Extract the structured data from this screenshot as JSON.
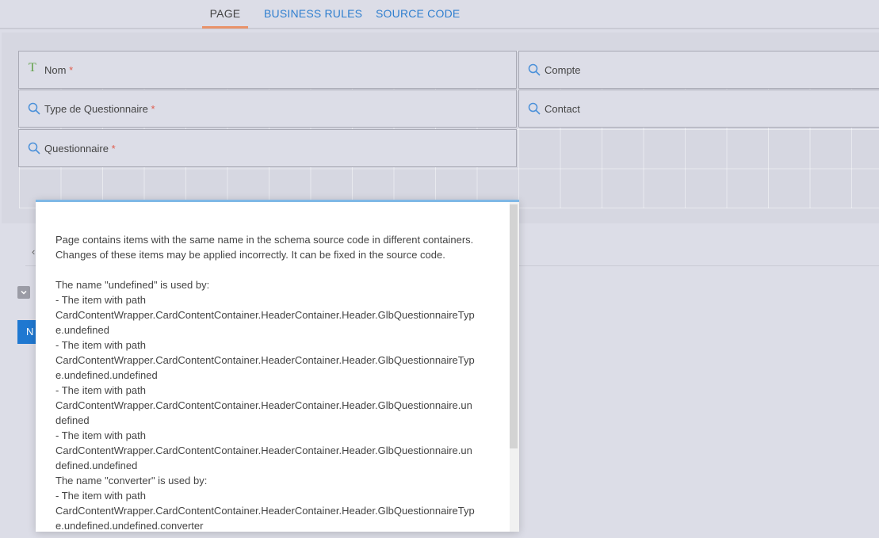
{
  "tabs": [
    {
      "label": "PAGE",
      "active": true
    },
    {
      "label": "BUSINESS RULES",
      "active": false
    },
    {
      "label": "SOURCE CODE",
      "active": false
    }
  ],
  "fields": {
    "nom": {
      "label": "Nom",
      "required": "*",
      "icon": "text-type-icon"
    },
    "compte": {
      "label": "Compte",
      "icon": "search-icon"
    },
    "type_questionnaire": {
      "label": "Type de Questionnaire",
      "required": "*",
      "icon": "search-icon"
    },
    "contact": {
      "label": "Contact",
      "icon": "search-icon"
    },
    "questionnaire": {
      "label": "Questionnaire",
      "required": "*",
      "icon": "search-icon"
    }
  },
  "lower": {
    "chevron": "‹",
    "button_label": "N"
  },
  "dialog": {
    "lines": [
      "Page contains items with the same name in the schema source code in different containers.",
      "Changes of these items may be applied incorrectly. It can be fixed in the source code.",
      "",
      "The name \"undefined\" is used by:",
      "- The item with path",
      "CardContentWrapper.CardContentContainer.HeaderContainer.Header.GlbQuestionnaireTyp",
      "e.undefined",
      "- The item with path",
      "CardContentWrapper.CardContentContainer.HeaderContainer.Header.GlbQuestionnaireTyp",
      "e.undefined.undefined",
      "- The item with path",
      "CardContentWrapper.CardContentContainer.HeaderContainer.Header.GlbQuestionnaire.un",
      "defined",
      "- The item with path",
      "CardContentWrapper.CardContentContainer.HeaderContainer.Header.GlbQuestionnaire.un",
      "defined.undefined",
      "The name \"converter\" is used by:",
      "- The item with path",
      "CardContentWrapper.CardContentContainer.HeaderContainer.Header.GlbQuestionnaireTyp",
      "e.undefined.undefined.converter"
    ]
  },
  "colors": {
    "accent": "#2f7fcf",
    "active_tab": "#e8936a",
    "required": "#e05d4e",
    "dialog_border": "#7fb8e6"
  }
}
